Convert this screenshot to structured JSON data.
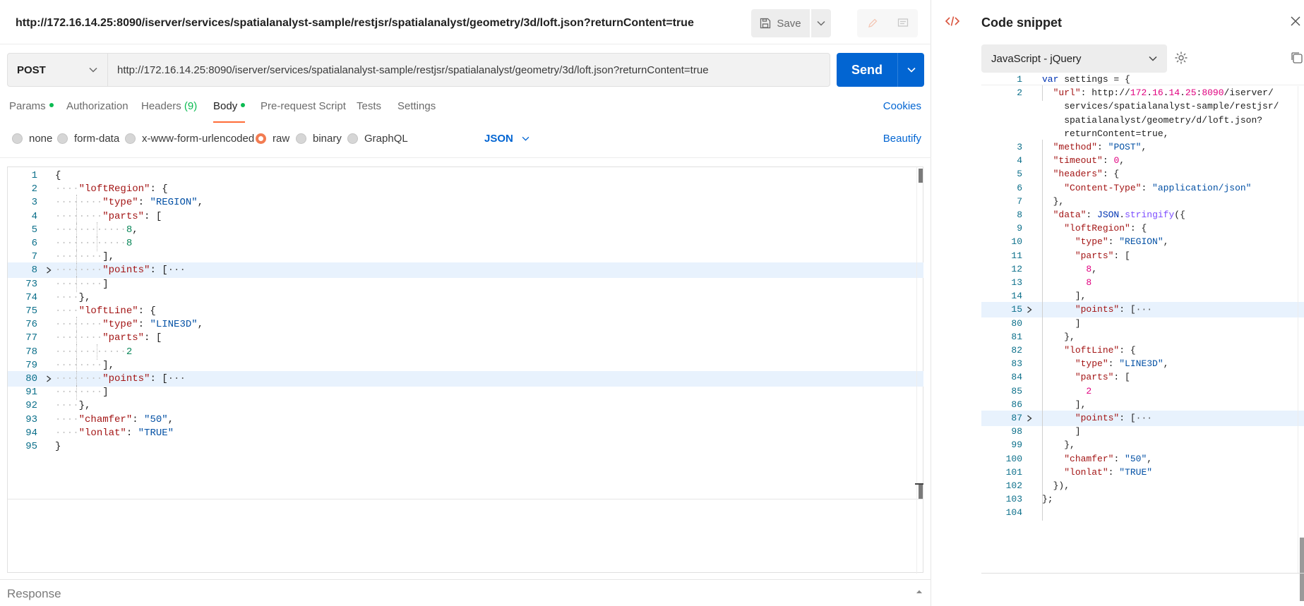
{
  "request": {
    "title": "http://172.16.14.25:8090/iserver/services/spatialanalyst-sample/restjsr/spatialanalyst/geometry/3d/loft.json?returnContent=true",
    "save_label": "Save",
    "method": "POST",
    "url": "http://172.16.14.25:8090/iserver/services/spatialanalyst-sample/restjsr/spatialanalyst/geometry/3d/loft.json?returnContent=true",
    "send_label": "Send"
  },
  "tabs": {
    "params": "Params",
    "authorization": "Authorization",
    "headers": "Headers",
    "headers_count": "(9)",
    "body": "Body",
    "prerequest": "Pre-request Script",
    "tests": "Tests",
    "settings": "Settings",
    "cookies": "Cookies"
  },
  "body_options": {
    "none": "none",
    "form_data": "form-data",
    "urlencoded": "x-www-form-urlencoded",
    "raw": "raw",
    "binary": "binary",
    "graphql": "GraphQL",
    "format": "JSON",
    "beautify": "Beautify"
  },
  "editor": {
    "lines": [
      {
        "n": "1",
        "t": "{"
      },
      {
        "n": "2",
        "t": "····\"loftRegion\": {"
      },
      {
        "n": "3",
        "t": "········\"type\": \"REGION\","
      },
      {
        "n": "4",
        "t": "········\"parts\": ["
      },
      {
        "n": "5",
        "t": "············8,"
      },
      {
        "n": "6",
        "t": "············8"
      },
      {
        "n": "7",
        "t": "········],"
      },
      {
        "n": "8",
        "t": "········\"points\": [···"
      },
      {
        "n": "73",
        "t": "········]"
      },
      {
        "n": "74",
        "t": "····},"
      },
      {
        "n": "75",
        "t": "····\"loftLine\": {"
      },
      {
        "n": "76",
        "t": "········\"type\": \"LINE3D\","
      },
      {
        "n": "77",
        "t": "········\"parts\": ["
      },
      {
        "n": "78",
        "t": "············2"
      },
      {
        "n": "79",
        "t": "········],"
      },
      {
        "n": "80",
        "t": "········\"points\": [···"
      },
      {
        "n": "91",
        "t": "········]"
      },
      {
        "n": "92",
        "t": "····},"
      },
      {
        "n": "93",
        "t": "····\"chamfer\": \"50\","
      },
      {
        "n": "94",
        "t": "····\"lonlat\": \"TRUE\""
      },
      {
        "n": "95",
        "t": "}"
      }
    ]
  },
  "response_label": "Response",
  "snippet": {
    "title": "Code snippet",
    "language": "JavaScript - jQuery",
    "lines": [
      {
        "n": "1",
        "t": "var settings = {"
      },
      {
        "n": "2",
        "t": "  \"url\": \"http://172.16.14.25:8090/iserver/"
      },
      {
        "n": "",
        "t": "    services/spatialanalyst-sample/restjsr/"
      },
      {
        "n": "",
        "t": "    spatialanalyst/geometry/3d/loft.json?"
      },
      {
        "n": "",
        "t": "    returnContent=true\","
      },
      {
        "n": "3",
        "t": "  \"method\": \"POST\","
      },
      {
        "n": "4",
        "t": "  \"timeout\": 0,"
      },
      {
        "n": "5",
        "t": "  \"headers\": {"
      },
      {
        "n": "6",
        "t": "    \"Content-Type\": \"application/json\""
      },
      {
        "n": "7",
        "t": "  },"
      },
      {
        "n": "8",
        "t": "  \"data\": JSON.stringify({"
      },
      {
        "n": "9",
        "t": "    \"loftRegion\": {"
      },
      {
        "n": "10",
        "t": "      \"type\": \"REGION\","
      },
      {
        "n": "11",
        "t": "      \"parts\": ["
      },
      {
        "n": "12",
        "t": "        8,"
      },
      {
        "n": "13",
        "t": "        8"
      },
      {
        "n": "14",
        "t": "      ],"
      },
      {
        "n": "15",
        "t": "      \"points\": [···"
      },
      {
        "n": "80",
        "t": "      ]"
      },
      {
        "n": "81",
        "t": "    },"
      },
      {
        "n": "82",
        "t": "    \"loftLine\": {"
      },
      {
        "n": "83",
        "t": "      \"type\": \"LINE3D\","
      },
      {
        "n": "84",
        "t": "      \"parts\": ["
      },
      {
        "n": "85",
        "t": "        2"
      },
      {
        "n": "86",
        "t": "      ],"
      },
      {
        "n": "87",
        "t": "      \"points\": [···"
      },
      {
        "n": "98",
        "t": "      ]"
      },
      {
        "n": "99",
        "t": "    },"
      },
      {
        "n": "100",
        "t": "    \"chamfer\": \"50\","
      },
      {
        "n": "101",
        "t": "    \"lonlat\": \"TRUE\""
      },
      {
        "n": "102",
        "t": "  }),"
      },
      {
        "n": "103",
        "t": "};"
      },
      {
        "n": "104",
        "t": ""
      }
    ]
  },
  "colors": {
    "accent": "#0265d2",
    "tab_indicator": "#ff6c37",
    "status_dot": "#0cbb52"
  }
}
